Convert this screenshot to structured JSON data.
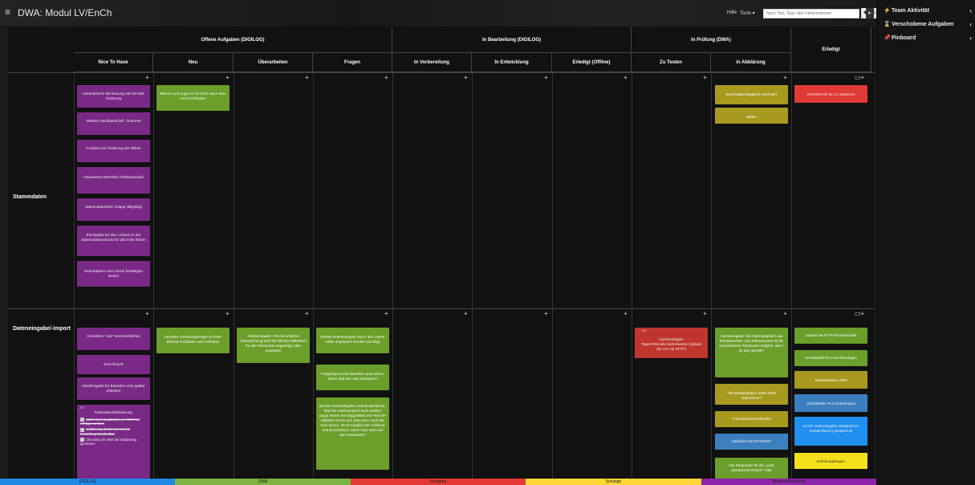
{
  "app": {
    "title": "DWA: Modul LV/EnCh"
  },
  "toolbar": {
    "hilfe": "Hilfe",
    "tools": "Tools ▾",
    "search_placeholder": "Nach Titel, Tags oder Kartennummer",
    "filter_icon": "filter-icon",
    "search_icon": "search-icon"
  },
  "sidebar": {
    "items": [
      {
        "icon": "⚡",
        "label": "Team Aktivität"
      },
      {
        "icon": "⌛",
        "label": "Verschobene Aufgaben"
      },
      {
        "icon": "📌",
        "label": "Pinboard"
      }
    ]
  },
  "board": {
    "groups": [
      "Offene Aufgaben (DIGILOG)",
      "In Bearbeitung (DIGILOG)",
      "In Prüfung (DWA)",
      "Erledigt"
    ],
    "columns": [
      "Nice To Have",
      "Neu",
      "Überarbeiten",
      "Fragen",
      "In Vorbereitung",
      "In Entwicklung",
      "Erledigt (Offline)",
      "Zu Testen",
      "in Abklärung"
    ],
    "rows": [
      "Stammdaten",
      "Dateneingabe/-import"
    ],
    "cards_row1": {
      "nth": [
        "Automatische Benennung GK bei EW-Änderung",
        "Weitere Nachbarschaft - Nummer",
        "Funktion bei Änderung der Wibes",
        "Hinweistext Betreiber Felderauswahl",
        "Stammdatenfeld: Anlage stillgelegt",
        "EW-Spalte bei den Lehrern in der Stammdatenansicht für alle links führen",
        "Stammdaten vom Lehrer bestätigen lassen"
      ],
      "neu": [
        "Bild KA und Logo KA für 2021 kann man nicht hochladen"
      ],
      "abkl": [
        "Stammdatenabgleich mit RUBT",
        "BBBA"
      ],
      "erledigt": [
        "Schreibrecht für LV aktivieren"
      ]
    },
    "cards_row2": {
      "nth": [
        "Checkliste \"und\" vereinheitlichen",
        "Excelimport",
        "Dateifreigabe für Betreiber und spätter erlauben",
        "Datenplausibilisierung"
      ],
      "checklist": [
        "Stufen bei Hauptkarten ver ROT auf richtigen ändern",
        "Validierung durch Grenzwerte Einstellung bearbeitbar",
        "Checkbox für Wert bei Validierung ignorieren"
      ],
      "checklist_count": "2/3",
      "neu": [
        "Aktuellen Erhebungsbogen in DWA Betrieb hochladen und verlinken"
      ],
      "ueber": [
        "Admineingabe: Für die amtliche Überwachung wird der falsche Mittelwert für alle Parameter angezeigt, bitte anpassen"
      ],
      "fragen": [
        "Direkte Dateneingabe durch den Lehrer sollte angepasst werden (wichtig)",
        "Freigabeprozess Betreiber und Lehrer: Wann darf wer was eintragen?",
        "Bei der Dateneingabe (Adminoberfläche, bitte für Lehreransicht auch prüfen) poppt immer bei Doppelklick ins Feld der Hilfetext rechts auf. Das kann nach der Zeit nerven. Ist es möglich den Hilfetext erst anzuklicken, wenn man oben auf den Parameter?"
      ],
      "zutesten": [
        "Importvorlagen Tages-/Monats-/Jahreswerte (Upload der csv mit SFTP)"
      ],
      "zutesten_meta": "145",
      "abkl": [
        "Admineingabe: Ein Datenabgleich aus Monatswerten und Jahreswerten ist für verschiedene Parameter möglich. Wer / ist das gewollt?",
        "Alle Betriebsdaten 2004-2009 importieren?",
        "Fremdwassermethoden",
        "Uploader DEAKTIVIERT",
        "Die Parameter für die „nicht abwassertechnisch\" bitte"
      ],
      "erledigt": [
        "Upload via sFTP Rechtemodell",
        "Schnittstelle PLS Excelvorlagen",
        "Betriebsdaten 2020",
        "Schnittstelle PLS Datenimport",
        "Art der Dateneingabe deaktivieren, sobald Bericht gesperrt ist",
        "Erhebungsbögen"
      ]
    }
  },
  "legend": [
    {
      "label": "DIGILOG",
      "color": "#1e88e5"
    },
    {
      "label": "DWA",
      "color": "#7cb342"
    },
    {
      "label": "Dringend",
      "color": "#e53935"
    },
    {
      "label": "Sonstige",
      "color": "#fdd835"
    },
    {
      "label": "Weiterentwicklung",
      "color": "#8e24aa"
    }
  ]
}
